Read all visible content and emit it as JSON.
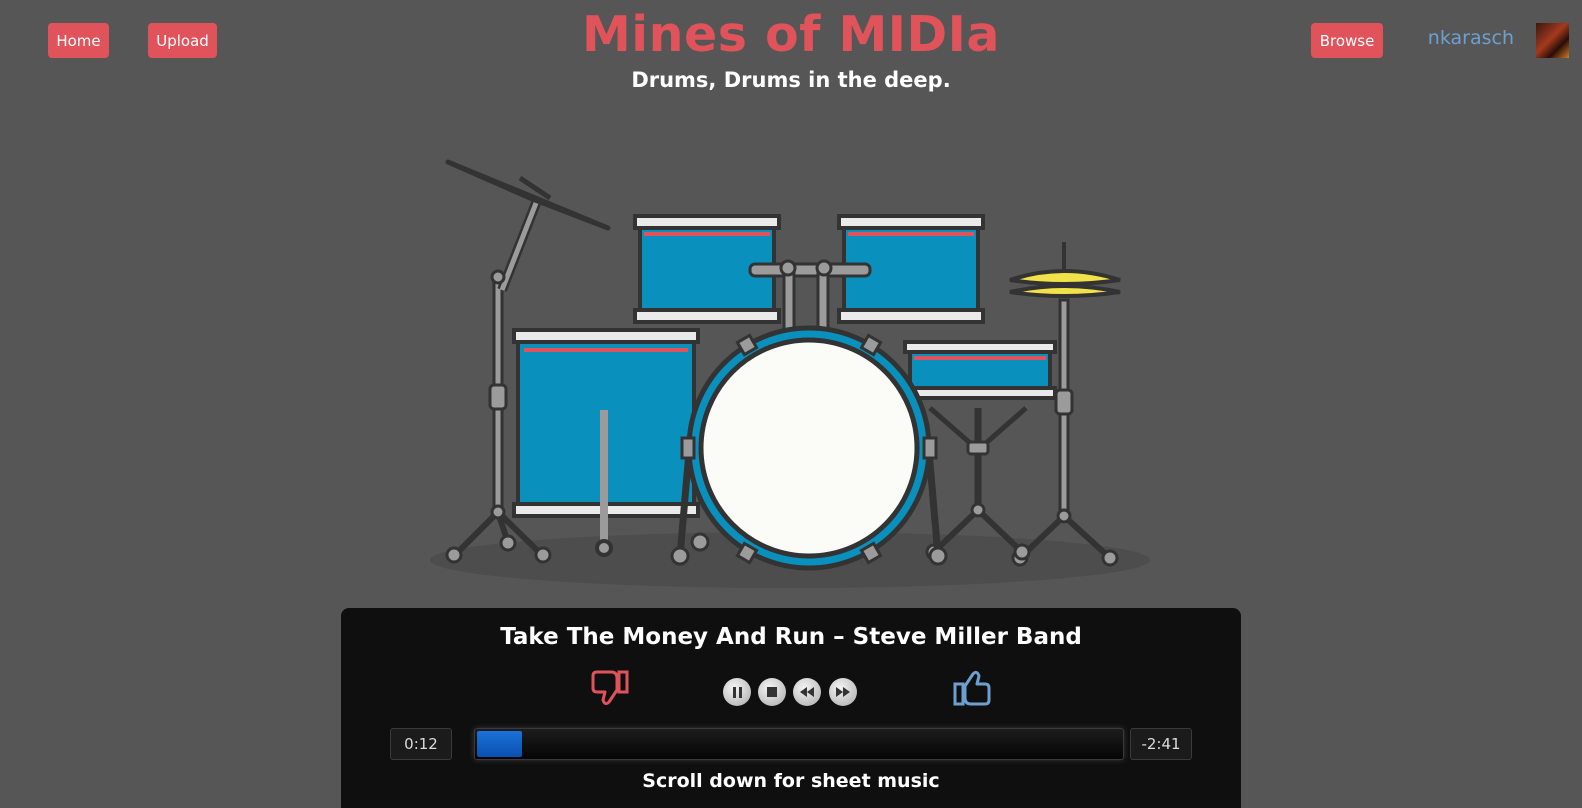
{
  "nav": {
    "home_label": "Home",
    "upload_label": "Upload",
    "browse_label": "Browse"
  },
  "header": {
    "title": "Mines of MIDIa",
    "subtitle": "Drums, Drums in the deep."
  },
  "user": {
    "username": "nkarasch"
  },
  "player": {
    "song_title": "Take The Money And Run – Steve Miller Band",
    "elapsed": "0:12",
    "remaining": "-2:41",
    "progress": 0.07,
    "scroll_hint": "Scroll down for sheet music",
    "controls": [
      "pause-icon",
      "stop-icon",
      "rewind-icon",
      "fast-forward-icon"
    ]
  },
  "colors": {
    "accent": "#e0535a",
    "link": "#6ea0cf",
    "drum_shell": "#0a90bd",
    "cymbal": "#f2e24a",
    "progress": "#1b72d8"
  }
}
